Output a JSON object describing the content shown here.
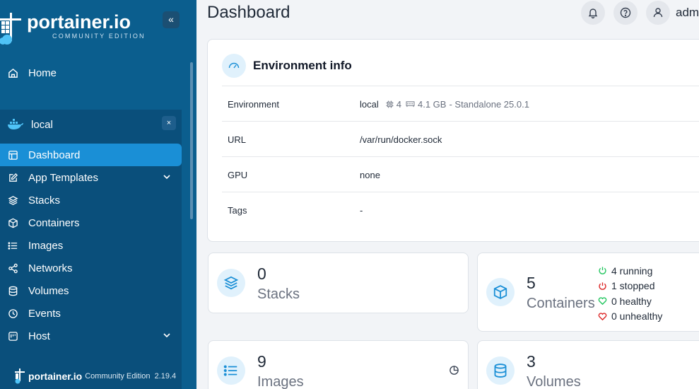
{
  "sidebar": {
    "brand": "portainer.io",
    "brand_sub": "COMMUNITY EDITION",
    "collapse_glyph": "«",
    "home_label": "Home",
    "environment": {
      "name": "local",
      "close_glyph": "×"
    },
    "items": [
      {
        "label": "Dashboard",
        "icon": "dashboard-icon",
        "active": true
      },
      {
        "label": "App Templates",
        "icon": "edit-icon",
        "expandable": true
      },
      {
        "label": "Stacks",
        "icon": "layers-icon"
      },
      {
        "label": "Containers",
        "icon": "box-icon"
      },
      {
        "label": "Images",
        "icon": "list-icon"
      },
      {
        "label": "Networks",
        "icon": "share-icon"
      },
      {
        "label": "Volumes",
        "icon": "database-icon"
      },
      {
        "label": "Events",
        "icon": "clock-icon"
      },
      {
        "label": "Host",
        "icon": "host-icon",
        "expandable": true
      }
    ],
    "footer": {
      "brand": "portainer.io",
      "edition": "Community Edition",
      "version": "2.19.4"
    }
  },
  "header": {
    "title": "Dashboard",
    "user_label": "admin"
  },
  "env_info": {
    "title": "Environment info",
    "rows": [
      {
        "key": "Environment",
        "name": "local",
        "cpu": "4",
        "memory": "4.1 GB",
        "suffix": "- Standalone 25.0.1"
      },
      {
        "key": "URL",
        "value": "/var/run/docker.sock"
      },
      {
        "key": "GPU",
        "value": "none"
      },
      {
        "key": "Tags",
        "value": "-"
      }
    ]
  },
  "stats": {
    "stacks": {
      "count": "0",
      "label": "Stacks"
    },
    "containers": {
      "count": "5",
      "label": "Containers",
      "states": [
        {
          "text": "4 running",
          "color": "#22c55e"
        },
        {
          "text": "1 stopped",
          "color": "#dc2626"
        },
        {
          "text": "0 healthy",
          "color": "#22c55e"
        },
        {
          "text": "0 unhealthy",
          "color": "#dc2626"
        }
      ]
    },
    "images": {
      "count": "9",
      "label": "Images"
    },
    "volumes": {
      "count": "3",
      "label": "Volumes"
    }
  },
  "colors": {
    "sidebar": "#0b5e8e",
    "active": "#1a8fd6",
    "accent": "#1a8fd6"
  }
}
